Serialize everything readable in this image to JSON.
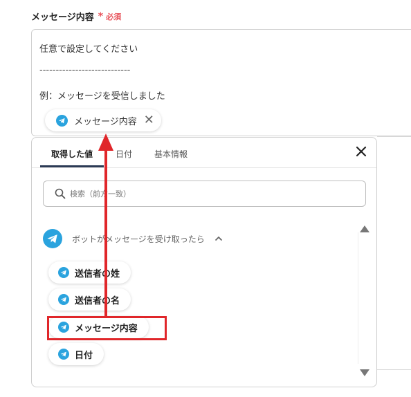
{
  "field": {
    "label": "メッセージ内容",
    "required_star": "*",
    "required_text": "必須"
  },
  "editor": {
    "line1": "任意で設定してください",
    "divider": "----------------------------",
    "line2": "例：メッセージを受信しました",
    "inserted_chip": "メッセージ内容"
  },
  "picker": {
    "tabs": [
      {
        "label": "取得した値"
      },
      {
        "label": "日付"
      },
      {
        "label": "基本情報"
      }
    ],
    "search_placeholder": "検索（前方一致）",
    "section_title": "ボットがメッセージを受け取ったら",
    "items": [
      {
        "label": "送信者の姓"
      },
      {
        "label": "送信者の名"
      },
      {
        "label": "メッセージ内容"
      },
      {
        "label": "日付"
      }
    ]
  },
  "colors": {
    "required": "#e8535b",
    "telegram": "#2aa3de",
    "highlight": "#e0262a",
    "tab_underline": "#2b3a55"
  }
}
